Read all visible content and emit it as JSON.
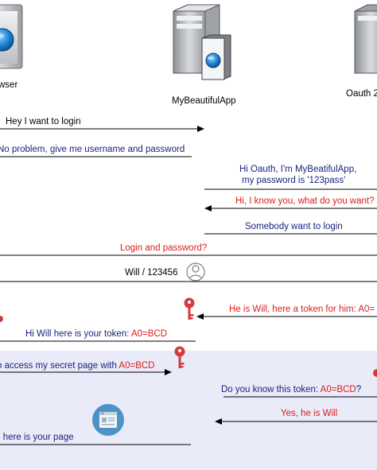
{
  "actors": {
    "browser": "wser",
    "app": "MyBeautifulApp",
    "oauth": "Oauth 2"
  },
  "colors": {
    "navy": "#1a237e",
    "red": "#e01b1b",
    "black": "#000000",
    "band": "#e9ebf8"
  },
  "messages": [
    {
      "id": "m1",
      "segments": [
        {
          "text": "Hey I want to login",
          "color": "black"
        }
      ]
    },
    {
      "id": "m2",
      "segments": [
        {
          "text": "No problem, give me username and password",
          "color": "navy"
        }
      ]
    },
    {
      "id": "m3a",
      "segments": [
        {
          "text": "Hi Oauth, I'm MyBeatifulApp,",
          "color": "navy"
        }
      ]
    },
    {
      "id": "m3b",
      "segments": [
        {
          "text": "my password is '123pass'",
          "color": "navy"
        }
      ]
    },
    {
      "id": "m4",
      "segments": [
        {
          "text": "Hi, I know you, what do you want?",
          "color": "red"
        }
      ]
    },
    {
      "id": "m5",
      "segments": [
        {
          "text": "Somebody want to login",
          "color": "navy"
        }
      ]
    },
    {
      "id": "m6",
      "segments": [
        {
          "text": "Login and password?",
          "color": "red"
        }
      ]
    },
    {
      "id": "m7",
      "segments": [
        {
          "text": "Will / 123456",
          "color": "black"
        }
      ]
    },
    {
      "id": "m8",
      "segments": [
        {
          "text": "He is Will, here a token for him: A0=",
          "color": "red"
        }
      ]
    },
    {
      "id": "m9",
      "segments": [
        {
          "text": "Hi Will here is your token: ",
          "color": "navy"
        },
        {
          "text": "A0=BCD",
          "color": "red"
        }
      ]
    },
    {
      "id": "m10",
      "segments": [
        {
          "text": "o access my secret page with ",
          "color": "navy"
        },
        {
          "text": "A0=BCD",
          "color": "red"
        }
      ]
    },
    {
      "id": "m11",
      "segments": [
        {
          "text": "Do you know this token: ",
          "color": "navy"
        },
        {
          "text": "A0=BCD",
          "color": "red"
        },
        {
          "text": "?",
          "color": "navy"
        }
      ]
    },
    {
      "id": "m12",
      "segments": [
        {
          "text": "Yes, he is Will",
          "color": "red"
        }
      ]
    },
    {
      "id": "m13",
      "segments": [
        {
          "text": "l here is your page",
          "color": "navy"
        }
      ]
    }
  ],
  "icons": [
    "browser-computer-icon",
    "app-server-icon",
    "oauth-server-icon",
    "user-icon",
    "key-icon",
    "webpage-icon"
  ]
}
